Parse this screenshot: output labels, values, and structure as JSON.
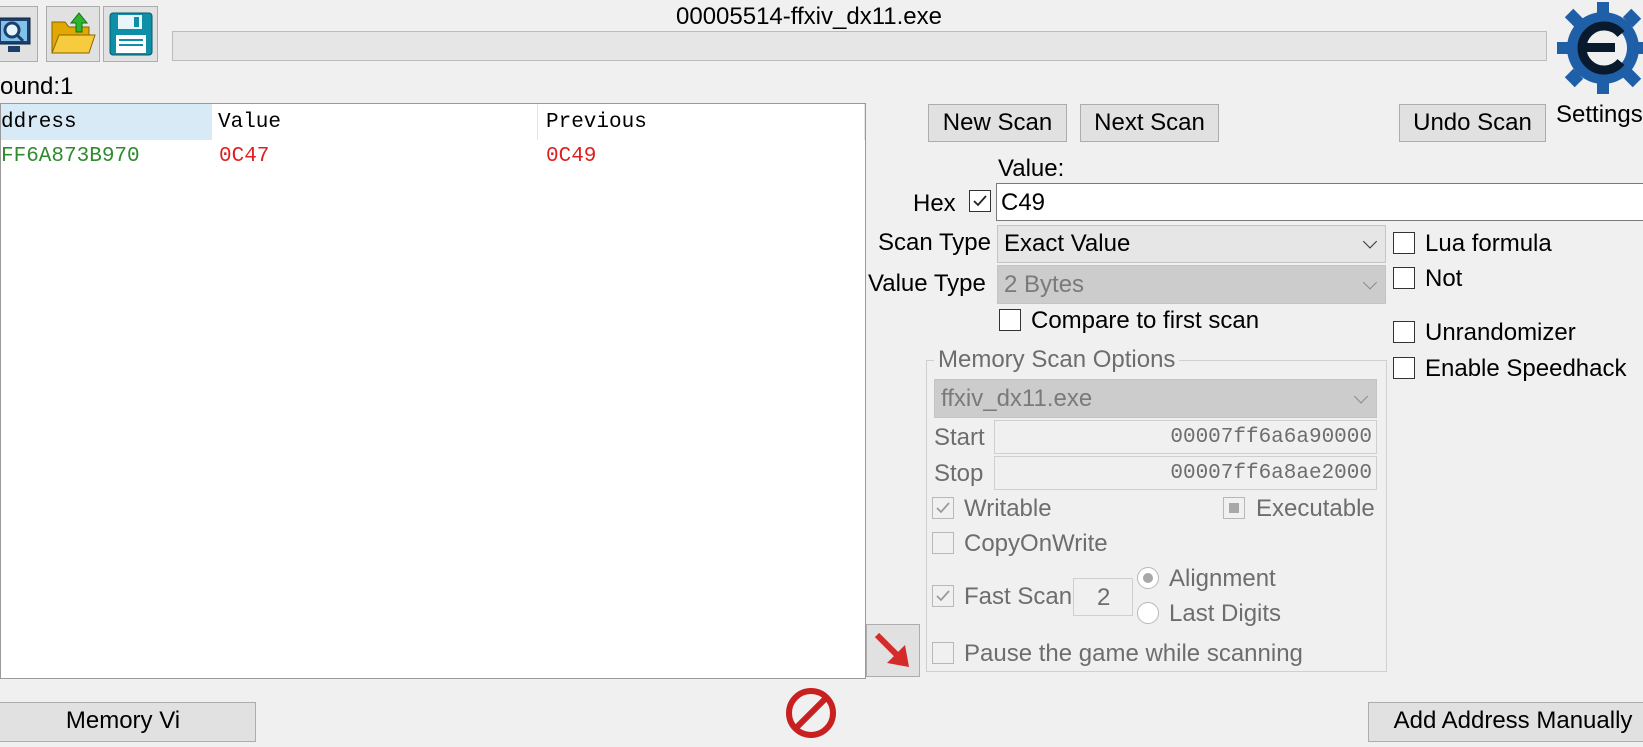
{
  "window": {
    "title": "00005514-ffxiv_dx11.exe"
  },
  "toolbar": {
    "open_process_icon": "monitor-magnifier-icon",
    "open_file_icon": "folder-open-icon",
    "save_icon": "floppy-disk-icon"
  },
  "found_label": "ound:1",
  "results": {
    "columns": [
      "ddress",
      "Value",
      "Previous"
    ],
    "rows": [
      {
        "address": "FF6A873B970",
        "value": "0C47",
        "previous": "0C49"
      }
    ]
  },
  "buttons": {
    "new_scan": "New Scan",
    "next_scan": "Next Scan",
    "undo_scan": "Undo Scan"
  },
  "settings_label": "Settings",
  "value_section": {
    "value_label": "Value:",
    "hex_label": "Hex",
    "hex_checked": true,
    "value_input": "C49"
  },
  "scan_type": {
    "label": "Scan Type",
    "selected": "Exact Value"
  },
  "value_type": {
    "label": "Value Type",
    "selected": "2 Bytes"
  },
  "compare_first_scan": "Compare to first scan",
  "right_options": {
    "lua_formula": "Lua formula",
    "not": "Not",
    "unrandomizer": "Unrandomizer",
    "enable_speedhack": "Enable Speedhack"
  },
  "memory_options": {
    "title": "Memory Scan Options",
    "module": "ffxiv_dx11.exe",
    "start_label": "Start",
    "start_value": "00007ff6a6a90000",
    "stop_label": "Stop",
    "stop_value": "00007ff6a8ae2000",
    "writable": "Writable",
    "executable": "Executable",
    "copy_on_write": "CopyOnWrite",
    "fast_scan": "Fast Scan",
    "fast_scan_value": "2",
    "alignment": "Alignment",
    "last_digits": "Last Digits",
    "pause_game": "Pause the game while scanning"
  },
  "bottom": {
    "memory_view": "Memory Vi",
    "add_address": "Add Address Manually"
  },
  "colors": {
    "address": "#2e8b2e",
    "changed_value": "#e02020",
    "header_selected": "#d9eaf7"
  }
}
